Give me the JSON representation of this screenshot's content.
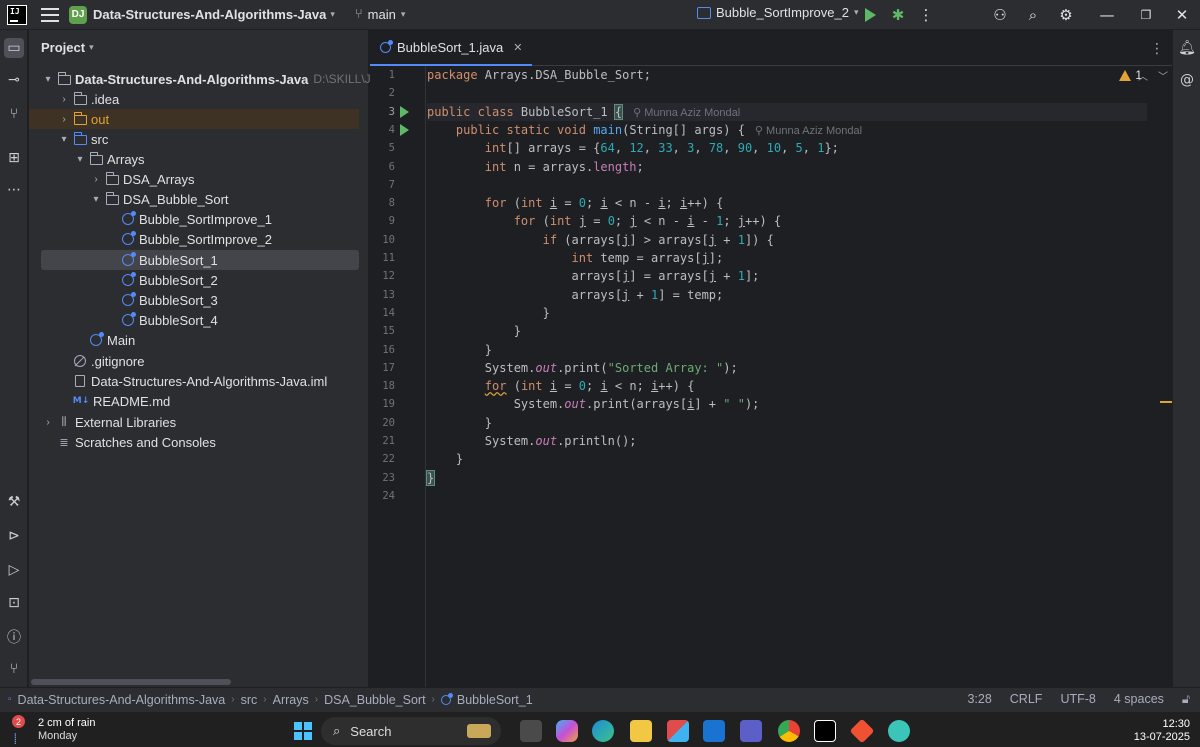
{
  "titlebar": {
    "project_badge": "DJ",
    "project_name": "Data-Structures-And-Algorithms-Java",
    "branch": "main",
    "run_config": "Bubble_SortImprove_2"
  },
  "project_panel": {
    "title": "Project",
    "tree": [
      {
        "label": "Data-Structures-And-Algorithms-Java",
        "hint": "D:\\SKILL\\JAVA\\D:",
        "icon": "folder-icon"
      },
      {
        "label": ".idea",
        "icon": "folder-icon"
      },
      {
        "label": "out",
        "icon": "folder-orange-icon"
      },
      {
        "label": "src",
        "icon": "folder-blue-icon"
      },
      {
        "label": "Arrays",
        "icon": "package-icon"
      },
      {
        "label": "DSA_Arrays",
        "icon": "package-icon"
      },
      {
        "label": "DSA_Bubble_Sort",
        "icon": "package-icon"
      },
      {
        "label": "Bubble_SortImprove_1",
        "icon": "class-icon"
      },
      {
        "label": "Bubble_SortImprove_2",
        "icon": "class-icon"
      },
      {
        "label": "BubbleSort_1",
        "icon": "class-icon"
      },
      {
        "label": "BubbleSort_2",
        "icon": "class-icon"
      },
      {
        "label": "BubbleSort_3",
        "icon": "class-icon"
      },
      {
        "label": "BubbleSort_4",
        "icon": "class-icon"
      },
      {
        "label": "Main",
        "icon": "class-icon"
      },
      {
        "label": ".gitignore",
        "icon": "gitignore-icon"
      },
      {
        "label": "Data-Structures-And-Algorithms-Java.iml",
        "icon": "file-icon"
      },
      {
        "label": "README.md",
        "icon": "markdown-icon"
      },
      {
        "label": "External Libraries",
        "icon": "library-icon"
      },
      {
        "label": "Scratches and Consoles",
        "icon": "scratches-icon"
      }
    ]
  },
  "editor": {
    "tab_label": "BubbleSort_1.java",
    "inspection_count": "1",
    "author_hint": "Munna Aziz Mondal",
    "line_numbers": [
      "1",
      "2",
      "3",
      "4",
      "5",
      "6",
      "7",
      "8",
      "9",
      "10",
      "11",
      "12",
      "13",
      "14",
      "15",
      "16",
      "17",
      "18",
      "19",
      "20",
      "21",
      "22",
      "23",
      "24"
    ]
  },
  "statusbar": {
    "breadcrumb": [
      "Data-Structures-And-Algorithms-Java",
      "src",
      "Arrays",
      "DSA_Bubble_Sort",
      "BubbleSort_1"
    ],
    "position": "3:28",
    "line_sep": "CRLF",
    "encoding": "UTF-8",
    "indent": "4 spaces"
  },
  "taskbar": {
    "weather_badge": "2",
    "weather_line1": "2 cm of rain",
    "weather_line2": "Monday",
    "search_label": "Search",
    "time": "12:30",
    "date": "13-07-2025"
  },
  "colors": {
    "accent": "#548af7",
    "run_green": "#5fb865",
    "warning": "#e1a336"
  }
}
